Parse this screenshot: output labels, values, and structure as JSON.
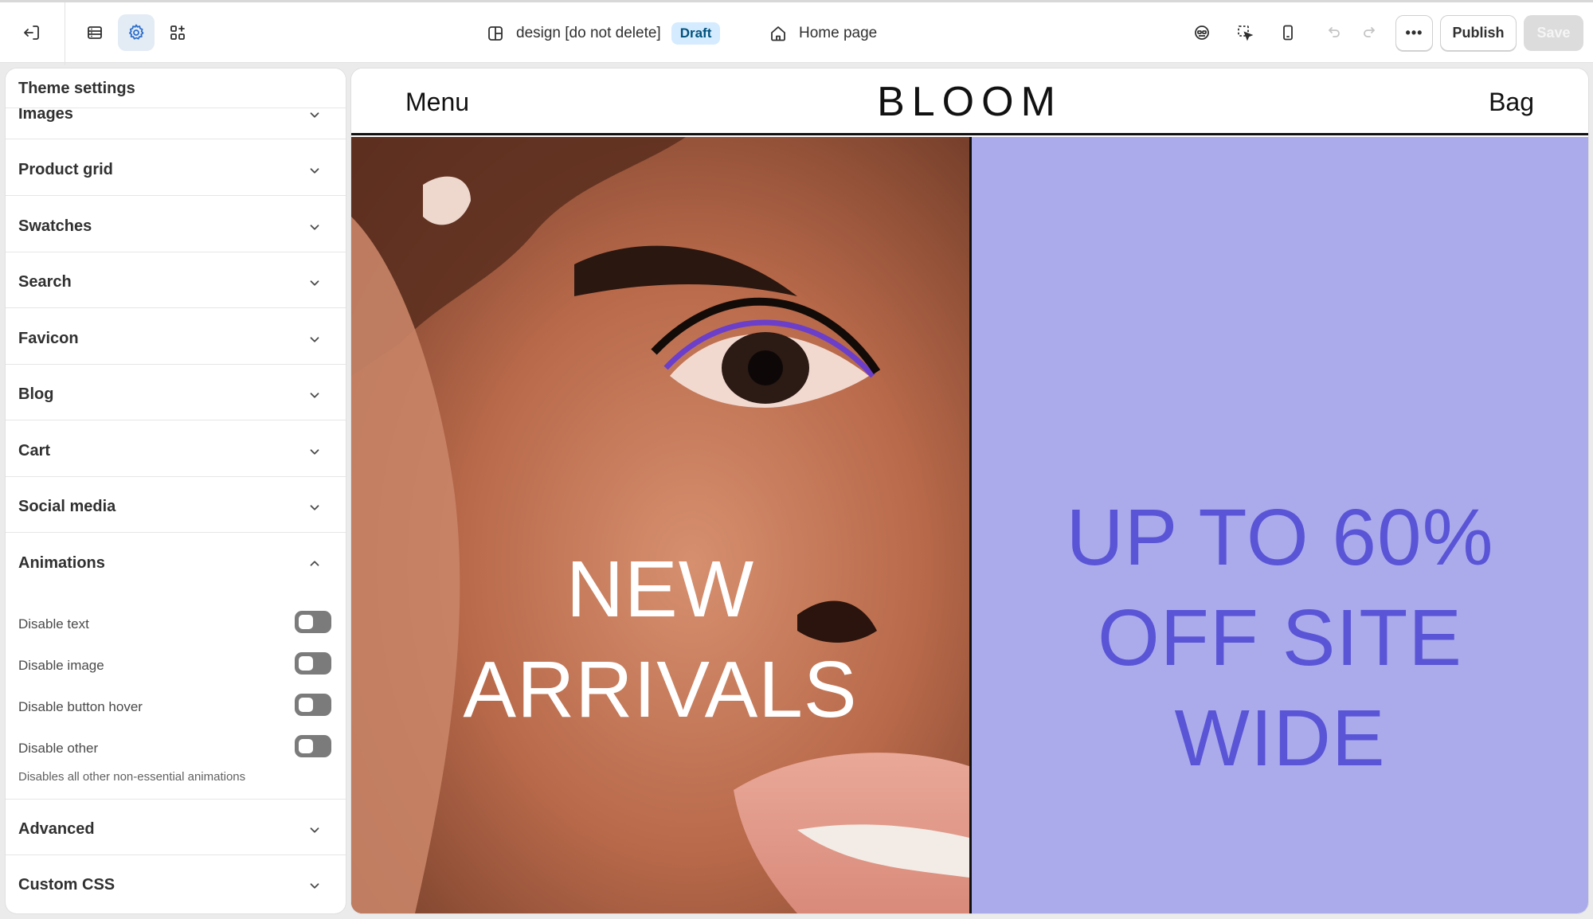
{
  "topbar": {
    "exit_icon": "exit-icon",
    "sections_icon": "sections-icon",
    "settings_icon": "gear-icon",
    "apps_icon": "apps-icon",
    "theme_name": "design [do not delete]",
    "theme_status": "Draft",
    "page_name": "Home page",
    "more_label": "•••",
    "publish_label": "Publish",
    "save_label": "Save",
    "accent_active_bg": "#e3ebf5"
  },
  "sidebar": {
    "title": "Theme settings",
    "sections": [
      {
        "label": "Images",
        "expanded": false
      },
      {
        "label": "Product grid",
        "expanded": false
      },
      {
        "label": "Swatches",
        "expanded": false
      },
      {
        "label": "Search",
        "expanded": false
      },
      {
        "label": "Favicon",
        "expanded": false
      },
      {
        "label": "Blog",
        "expanded": false
      },
      {
        "label": "Cart",
        "expanded": false
      },
      {
        "label": "Social media",
        "expanded": false
      },
      {
        "label": "Animations",
        "expanded": true
      },
      {
        "label": "Advanced",
        "expanded": false
      },
      {
        "label": "Custom CSS",
        "expanded": false
      }
    ],
    "animations": {
      "toggles": [
        {
          "label": "Disable text",
          "on": false
        },
        {
          "label": "Disable image",
          "on": false
        },
        {
          "label": "Disable button hover",
          "on": false
        },
        {
          "label": "Disable other",
          "on": false
        }
      ],
      "help": "Disables all other non-essential animations"
    }
  },
  "preview": {
    "menu": "Menu",
    "logo": "BLOOM",
    "bag": "Bag",
    "left_banner": [
      "NEW",
      "ARRIVALS"
    ],
    "right_banner": [
      "UP TO 60%",
      "OFF SITE",
      "WIDE"
    ],
    "right_bg": "#ababeb",
    "right_text_color": "#5a55d6"
  }
}
